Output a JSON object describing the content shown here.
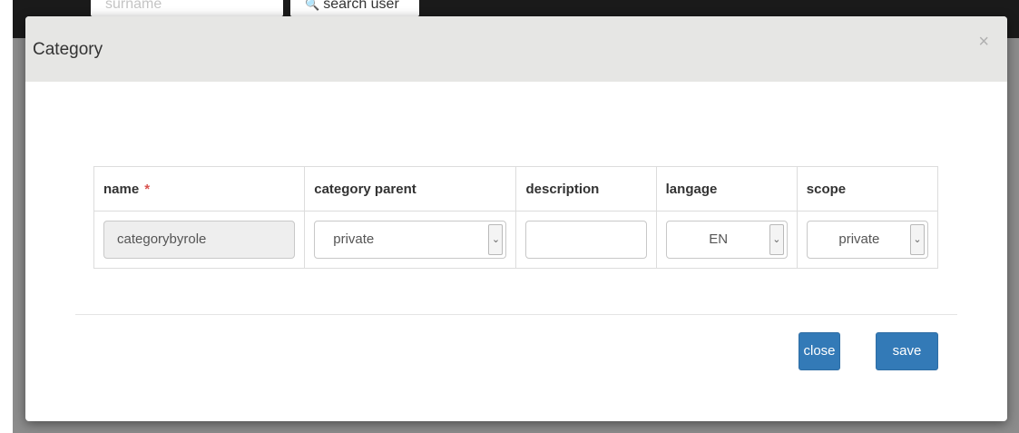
{
  "background": {
    "search_input_placeholder": "surname",
    "search_button_label": "search user"
  },
  "modal": {
    "title": "Category",
    "close_symbol": "×",
    "table": {
      "headers": {
        "name": "name",
        "required_marker": "*",
        "category_parent": "category parent",
        "description": "description",
        "langage": "langage",
        "scope": "scope"
      },
      "row": {
        "name_value": "categorybyrole",
        "category_parent_value": "private",
        "description_value": "",
        "langage_value": "EN",
        "scope_value": "private"
      }
    },
    "buttons": {
      "close_label": "close",
      "save_label": "save"
    }
  },
  "colors": {
    "primary_button": "#337ab7",
    "header_bg": "#e6e6e4",
    "required": "#d9534f"
  },
  "icons": {
    "search": "magnifier-icon",
    "dropdown": "chevron-down-icon",
    "close": "close-icon"
  }
}
